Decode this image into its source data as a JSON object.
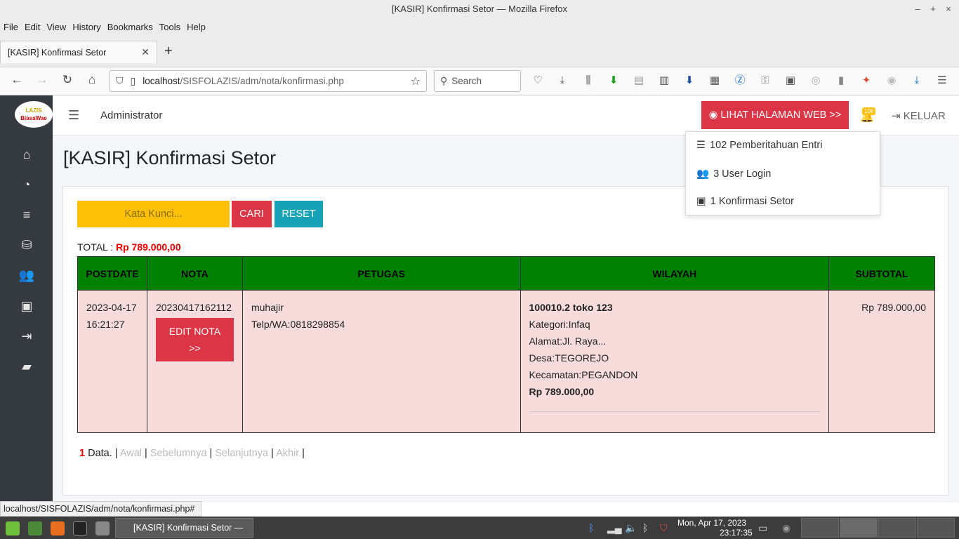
{
  "window": {
    "title": "[KASIR] Konfirmasi Setor — Mozilla Firefox",
    "controls": [
      "–",
      "+",
      "×"
    ]
  },
  "menubar": [
    "File",
    "Edit",
    "View",
    "History",
    "Bookmarks",
    "Tools",
    "Help"
  ],
  "tab": {
    "label": "[KASIR] Konfirmasi Setor",
    "close": "✕",
    "new": "+"
  },
  "navbar": {
    "url_host": "localhost",
    "url_path": "/SISFOLAZIS/adm/nota/konfirmasi.php",
    "search_placeholder": "Search"
  },
  "logo": {
    "line1": "LAZIS",
    "line2": "BiasaWae"
  },
  "header": {
    "menu_icon": "hamburger-icon",
    "user": "Administrator",
    "web_button": "LIHAT HALAMAN WEB >>",
    "notif_count": "106",
    "logout": "KELUAR"
  },
  "notifications": [
    {
      "icon": "server-icon",
      "label": "102 Pemberitahuan Entri"
    },
    {
      "icon": "users-icon",
      "label": "3 User Login"
    },
    {
      "icon": "money-icon",
      "label": "1 Konfirmasi Setor"
    }
  ],
  "page": {
    "title": "[KASIR] Konfirmasi Setor",
    "search_placeholder": "Kata Kunci...",
    "search_button": "CARI",
    "reset_button": "RESET",
    "total_label": "TOTAL :",
    "total_value": "Rp 789.000,00"
  },
  "table": {
    "headers": [
      "POSTDATE",
      "NOTA",
      "PETUGAS",
      "WILAYAH",
      "SUBTOTAL"
    ],
    "row": {
      "date": "2023-04-17",
      "time": "16:21:27",
      "nota": "20230417162112",
      "edit_line1": "EDIT NOTA",
      "edit_line2": ">>",
      "petugas_name": "muhajir",
      "petugas_phone": "Telp/WA:0818298854",
      "wilayah_name": "100010.2 toko 123",
      "kategori": "Kategori:Infaq",
      "alamat": "Alamat:Jl. Raya...",
      "desa": "Desa:TEGOREJO",
      "kecamatan": "Kecamatan:PEGANDON",
      "wilayah_amount": "Rp 789.000,00",
      "subtotal": "Rp 789.000,00"
    }
  },
  "pager": {
    "count": "1",
    "data_label": "Data.",
    "first": "Awal",
    "prev": "Sebelumnya",
    "next": "Selanjutnya",
    "last": "Akhir"
  },
  "statusbar": "localhost/SISFOLAZIS/adm/nota/konfirmasi.php#",
  "taskbar": {
    "window_label": "[KASIR] Konfirmasi Setor — ...",
    "date": "Mon, Apr 17, 2023",
    "time": "23:17:35"
  },
  "colors": {
    "danger": "#dc3545",
    "warning": "#ffc107",
    "info": "#17a2b8",
    "table_header": "#008000",
    "row_bg": "#f8dcdc",
    "sidebar": "#343a40"
  }
}
